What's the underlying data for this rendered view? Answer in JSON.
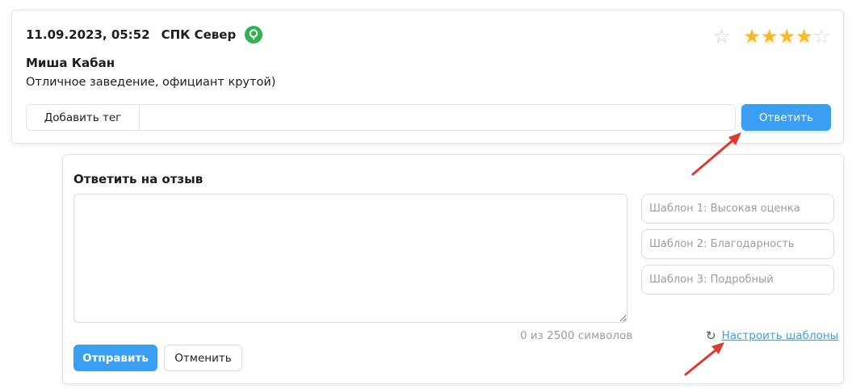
{
  "review": {
    "date": "11.09.2023, 05:52",
    "place": "СПК Север",
    "source_icon": "green-place-icon",
    "rating": 4,
    "rating_max": 5,
    "author": "Миша Кабан",
    "text": "Отличное заведение, официант крутой)",
    "add_tag_label": "Добавить тег",
    "reply_label": "Ответить"
  },
  "reply_panel": {
    "title": "Ответить на отзыв",
    "textarea_value": "",
    "char_count": "0 из 2500 символов",
    "templates": [
      "Шаблон 1: Высокая оценка",
      "Шаблон 2: Благодарность",
      "Шаблон 3: Подробный"
    ],
    "configure_templates": "Настроить шаблоны",
    "send_label": "Отправить",
    "cancel_label": "Отменить"
  },
  "colors": {
    "accent": "#3a9ef2",
    "star": "#f5b92b",
    "source": "#2fb350",
    "annotation": "#e03a2f"
  }
}
